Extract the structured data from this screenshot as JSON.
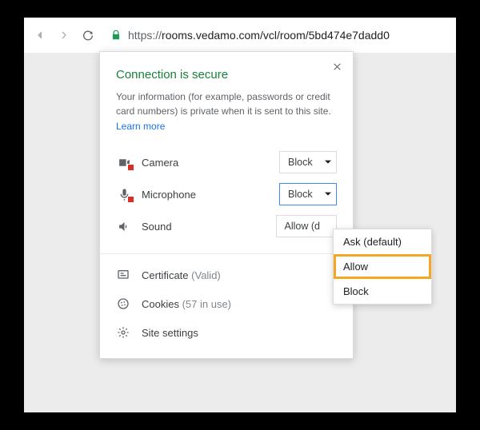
{
  "toolbar": {
    "url_proto": "https://",
    "url_rest": "rooms.vedamo.com/vcl/room/5bd474e7dadd0"
  },
  "popover": {
    "title": "Connection is secure",
    "description": "Your information (for example, passwords or credit card numbers) is private when it is sent to this site.",
    "learn_more": "Learn more",
    "permissions": {
      "camera": {
        "label": "Camera",
        "value": "Block"
      },
      "microphone": {
        "label": "Microphone",
        "value": "Block"
      },
      "sound": {
        "label": "Sound",
        "value": "Allow (d"
      }
    },
    "info": {
      "certificate_label": "Certificate",
      "certificate_status": "(Valid)",
      "cookies_label": "Cookies",
      "cookies_status": "(57 in use)",
      "site_settings": "Site settings"
    }
  },
  "menu": {
    "items": [
      "Ask (default)",
      "Allow",
      "Block"
    ],
    "highlighted": "Allow"
  }
}
